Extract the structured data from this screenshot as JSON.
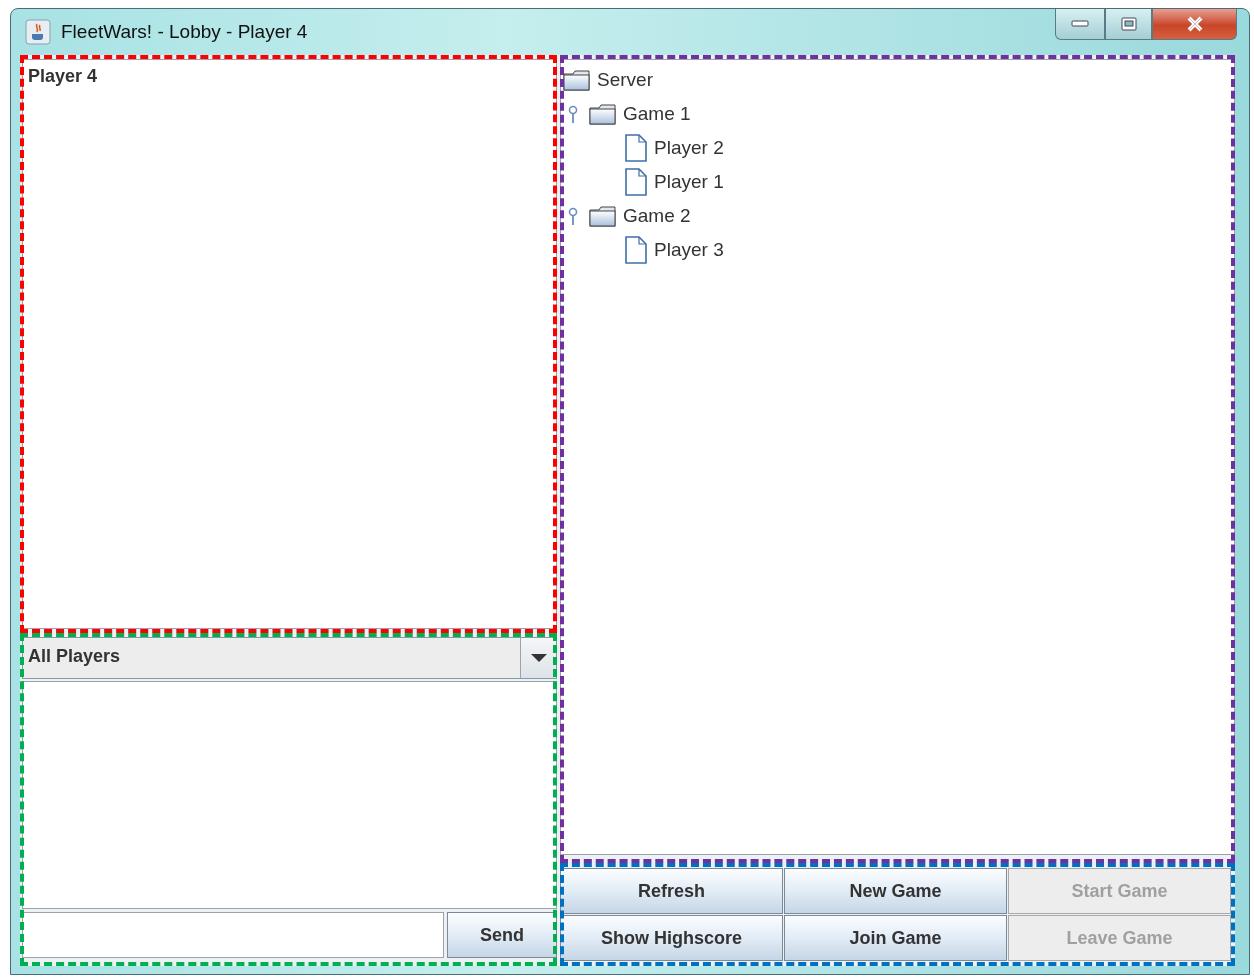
{
  "window": {
    "title": "FleetWars! - Lobby - Player 4"
  },
  "chat_log": {
    "color": "#ff0000",
    "lines": [
      "Player 4"
    ]
  },
  "message_panel": {
    "color": "#00b050",
    "recipient": "All Players",
    "send_button": "Send"
  },
  "server_tree": {
    "color": "#7030a0",
    "root": {
      "label": "Server",
      "kind": "folder",
      "children": [
        {
          "label": "Game 1",
          "kind": "folder",
          "expanded": true,
          "children": [
            {
              "label": "Player 2",
              "kind": "file"
            },
            {
              "label": "Player 1",
              "kind": "file"
            }
          ]
        },
        {
          "label": "Game 2",
          "kind": "folder",
          "expanded": true,
          "children": [
            {
              "label": "Player 3",
              "kind": "file"
            }
          ]
        }
      ]
    }
  },
  "action_buttons": {
    "color": "#0070c0",
    "buttons": [
      {
        "label": "Refresh",
        "disabled": false
      },
      {
        "label": "New Game",
        "disabled": false
      },
      {
        "label": "Start Game",
        "disabled": true
      },
      {
        "label": "Show Highscore",
        "disabled": false
      },
      {
        "label": "Join Game",
        "disabled": false
      },
      {
        "label": "Leave Game",
        "disabled": true
      }
    ]
  }
}
